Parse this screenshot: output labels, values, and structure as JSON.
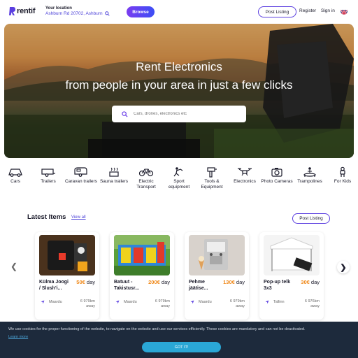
{
  "header": {
    "logo": "rentif",
    "location_title": "Your location",
    "location_value": "Ashburn Rd 20702, Ashburn",
    "browse_label": "Browse",
    "post_listing_label": "Post Listing",
    "register_label": "Register",
    "signin_label": "Sign in",
    "language_flag": "uk-flag-icon"
  },
  "hero": {
    "title": "Rent Electronics",
    "subtitle": "from people in your area in just a few clicks",
    "search_placeholder": "Cars, drones, electronics etc"
  },
  "categories": [
    {
      "label": "Cars",
      "icon": "car-icon"
    },
    {
      "label": "Trailers",
      "icon": "trailer-icon"
    },
    {
      "label": "Caravan trailers",
      "icon": "caravan-icon"
    },
    {
      "label": "Sauna trailers",
      "icon": "sauna-icon"
    },
    {
      "label": "Electric Transport",
      "icon": "bicycle-icon"
    },
    {
      "label": "Sport equipment",
      "icon": "sport-icon"
    },
    {
      "label": "Tools & Equipment",
      "icon": "tools-icon"
    },
    {
      "label": "Electronics",
      "icon": "drone-icon"
    },
    {
      "label": "Photo Cameras",
      "icon": "camera-icon"
    },
    {
      "label": "Trampolines",
      "icon": "trampoline-icon"
    },
    {
      "label": "For Kids",
      "icon": "kids-icon"
    }
  ],
  "latest": {
    "title": "Latest Items",
    "view_all": "View all",
    "post_listing_label": "Post Listing",
    "items": [
      {
        "name": "Külma Joogi / Slush'i...",
        "price": "50€",
        "unit": "day",
        "location": "Maardu",
        "distance": "6 979km away"
      },
      {
        "name": "Batuut - Takistusr...",
        "price": "200€",
        "unit": "day",
        "location": "Maardu",
        "distance": "6 979km away"
      },
      {
        "name": "Pehme jäätise...",
        "price": "130€",
        "unit": "day",
        "location": "Maardu",
        "distance": "6 979km away"
      },
      {
        "name": "Pop-up telk 3x3",
        "price": "30€",
        "unit": "day",
        "location": "Tallinn",
        "distance": "6 976km away"
      }
    ]
  },
  "cookie": {
    "text": "We use cookies for the proper functioning of the website, to navigate on the website and use our services efficiently. These cookies are mandatory and can not be deactivated.",
    "link": "Learn more",
    "button": "GOT IT!"
  },
  "colors": {
    "accent": "#5a3ee0",
    "price": "#f08a1c",
    "cookie_bg": "#1d2a3c",
    "cookie_btn": "#2aa7d6"
  }
}
